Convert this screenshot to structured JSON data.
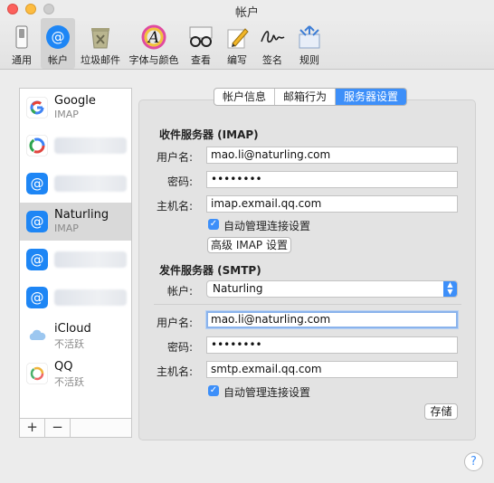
{
  "window": {
    "title": "帐户"
  },
  "toolbar": {
    "items": [
      {
        "label": "通用",
        "icon": "switch-icon"
      },
      {
        "label": "帐户",
        "icon": "at-sign-icon"
      },
      {
        "label": "垃圾邮件",
        "icon": "trash-bin-icon"
      },
      {
        "label": "字体与颜色",
        "icon": "font-colors-icon"
      },
      {
        "label": "查看",
        "icon": "glasses-icon"
      },
      {
        "label": "编写",
        "icon": "pencil-icon"
      },
      {
        "label": "签名",
        "icon": "signature-icon"
      },
      {
        "label": "规则",
        "icon": "rules-icon"
      }
    ]
  },
  "sidebar": {
    "accounts": [
      {
        "name": "Google",
        "sub": "IMAP",
        "icon": "google-icon"
      },
      {
        "name": "",
        "sub": "",
        "icon": "google-drive-icon"
      },
      {
        "name": "",
        "sub": "",
        "icon": "at-sign-icon"
      },
      {
        "name": "Naturling",
        "sub": "IMAP",
        "icon": "at-sign-icon",
        "selected": true
      },
      {
        "name": "",
        "sub": "",
        "icon": "at-sign-icon"
      },
      {
        "name": "",
        "sub": "",
        "icon": "at-sign-icon"
      },
      {
        "name": "iCloud",
        "sub": "不活跃",
        "icon": "cloud-icon"
      },
      {
        "name": "QQ",
        "sub": "不活跃",
        "icon": "qq-icon"
      }
    ],
    "add_label": "+",
    "remove_label": "−"
  },
  "tabs": [
    {
      "label": "帐户信息"
    },
    {
      "label": "邮箱行为"
    },
    {
      "label": "服务器设置",
      "active": true
    }
  ],
  "incoming": {
    "header": "收件服务器 (IMAP)",
    "username_label": "用户名:",
    "username": "mao.li@naturling.com",
    "password_label": "密码:",
    "password": "••••••••",
    "host_label": "主机名:",
    "host": "imap.exmail.qq.com",
    "auto_manage_label": "自动管理连接设置",
    "auto_manage_checked": true,
    "advanced_button": "高级 IMAP 设置"
  },
  "outgoing": {
    "header": "发件服务器 (SMTP)",
    "account_label": "帐户:",
    "account_value": "Naturling",
    "username_label": "用户名:",
    "username": "mao.li@naturling.com",
    "password_label": "密码:",
    "password": "••••••••",
    "host_label": "主机名:",
    "host": "smtp.exmail.qq.com",
    "auto_manage_label": "自动管理连接设置",
    "auto_manage_checked": true
  },
  "save_button": "存储",
  "help_label": "?",
  "colors": {
    "accent": "#3d8ff9",
    "at_icon_blue": "#1e86f5"
  }
}
